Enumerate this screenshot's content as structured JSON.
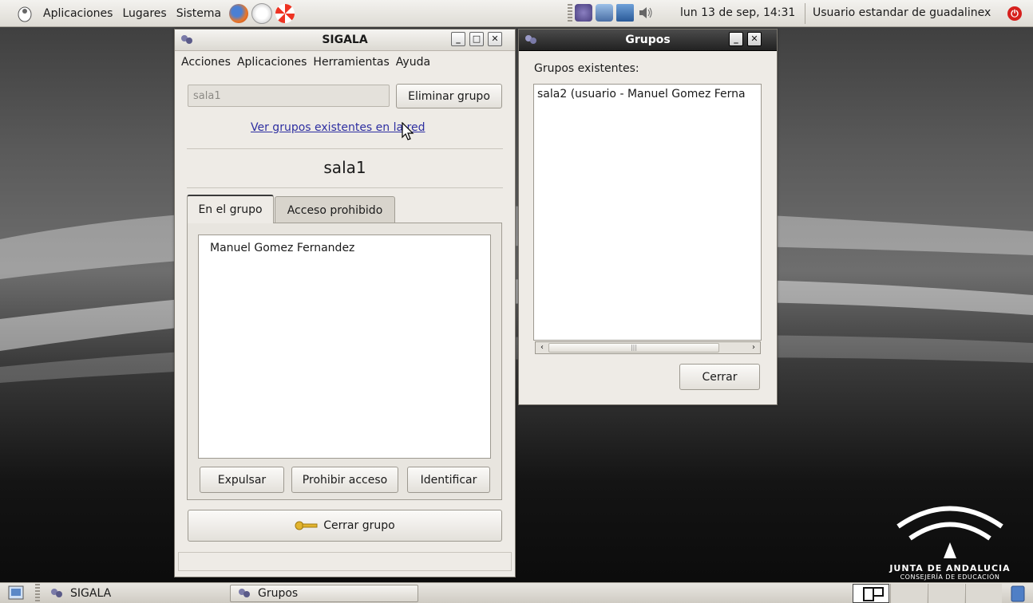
{
  "top_panel": {
    "menus": [
      "Aplicaciones",
      "Lugares",
      "Sistema"
    ],
    "clock": "lun 13 de sep, 14:31",
    "user": "Usuario estandar de guadalinex"
  },
  "sigala_window": {
    "title": "SIGALA",
    "menu": [
      "Acciones",
      "Aplicaciones",
      "Herramientas",
      "Ayuda"
    ],
    "group_entry_value": "sala1",
    "delete_group_label": "Eliminar grupo",
    "view_groups_link": "Ver grupos existentes en la red",
    "group_heading": "sala1",
    "tabs": [
      "En el grupo",
      "Acceso prohibido"
    ],
    "members": [
      "Manuel Gomez Fernandez"
    ],
    "buttons": {
      "expel": "Expulsar",
      "forbid": "Prohibir acceso",
      "identify": "Identificar",
      "close_group": "Cerrar grupo"
    }
  },
  "grupos_window": {
    "title": "Grupos",
    "label": "Grupos existentes:",
    "groups": [
      "sala2 (usuario - Manuel Gomez Ferna"
    ],
    "close_label": "Cerrar"
  },
  "bottom_panel": {
    "tasks": [
      "SIGALA",
      "Grupos"
    ]
  },
  "logo": {
    "line1": "JUNTA DE ANDALUCIA",
    "line2": "CONSEJERÍA DE EDUCACIÓN"
  },
  "colors": {
    "link": "#2e2fa1",
    "power": "#d6201d",
    "panel": "#dedbd4"
  }
}
